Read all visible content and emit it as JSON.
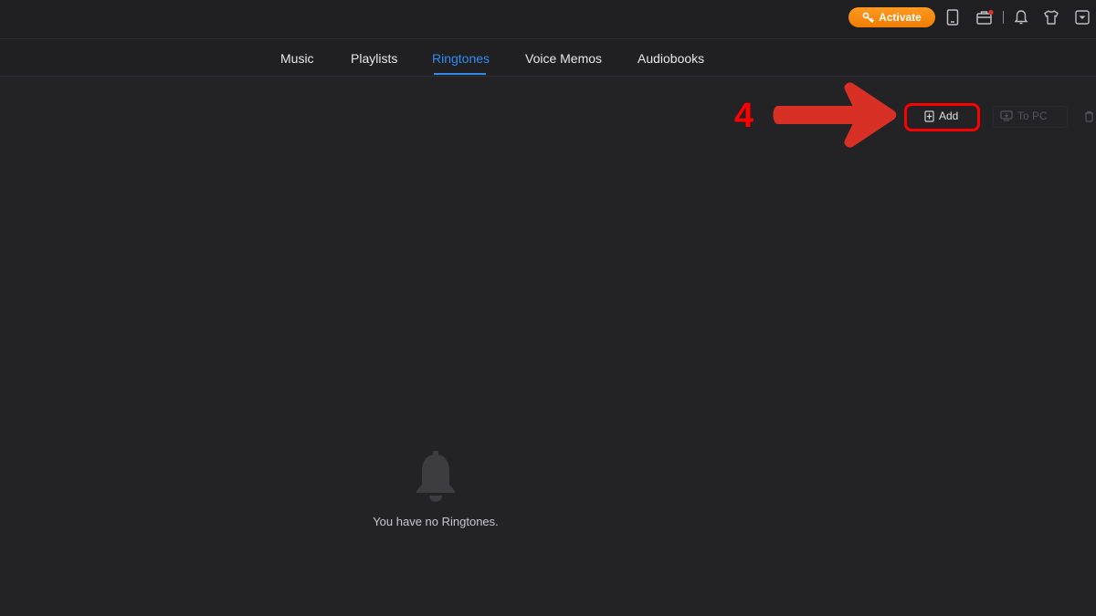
{
  "titlebar": {
    "activate_label": "Activate",
    "icons": [
      "device-icon",
      "toolbox-icon",
      "bell-icon",
      "tshirt-icon",
      "menu-dropdown-icon"
    ]
  },
  "tabs": [
    {
      "label": "Music",
      "active": false
    },
    {
      "label": "Playlists",
      "active": false
    },
    {
      "label": "Ringtones",
      "active": true
    },
    {
      "label": "Voice Memos",
      "active": false
    },
    {
      "label": "Audiobooks",
      "active": false
    }
  ],
  "toolbar": {
    "add_label": "Add",
    "to_pc_label": "To PC"
  },
  "annotation": {
    "step_number": "4"
  },
  "empty_state": {
    "message": "You have no Ringtones."
  },
  "colors": {
    "accent": "#2e8cf0",
    "activate": "#f58a0c",
    "annotation_red": "#ff0000",
    "arrow_red": "#d93025",
    "background": "#232326"
  }
}
